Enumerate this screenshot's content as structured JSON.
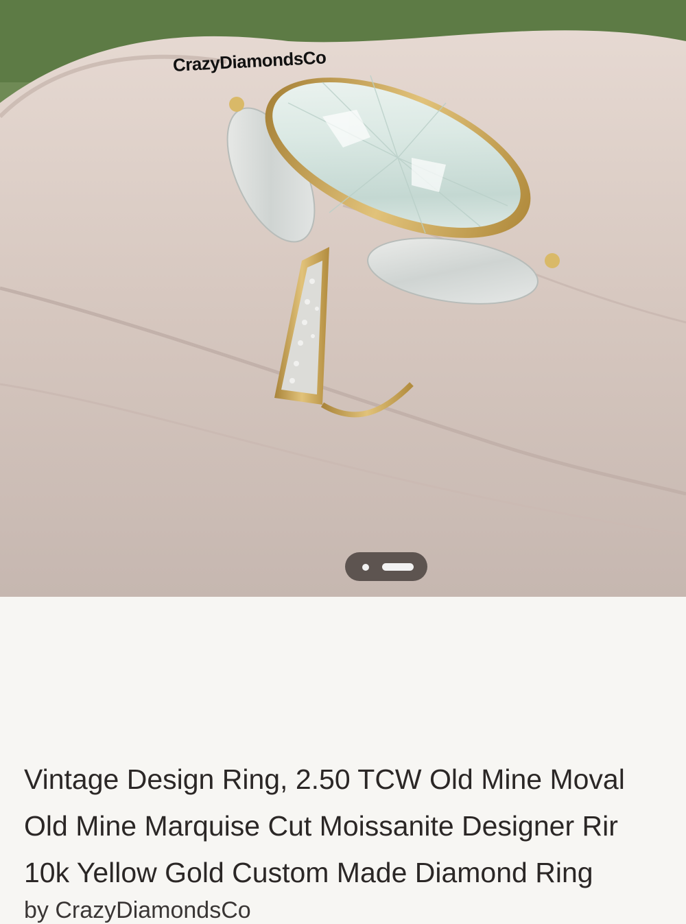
{
  "listing": {
    "image": {
      "watermark": "CrazyDiamondsCo",
      "image_count": 2,
      "current_index": 2
    },
    "title_lines": [
      "Vintage Design Ring, 2.50 TCW Old Mine Moval",
      "Old Mine Marquise Cut Moissanite Designer Rir",
      "10k Yellow Gold Custom Made Diamond Ring"
    ],
    "byline": "by CrazyDiamondsCo"
  },
  "colors": {
    "background": "#f7f6f3",
    "title_text": "#2b2726",
    "pager_bg": "#463e3a",
    "ring_gold": "#c9a24a"
  }
}
